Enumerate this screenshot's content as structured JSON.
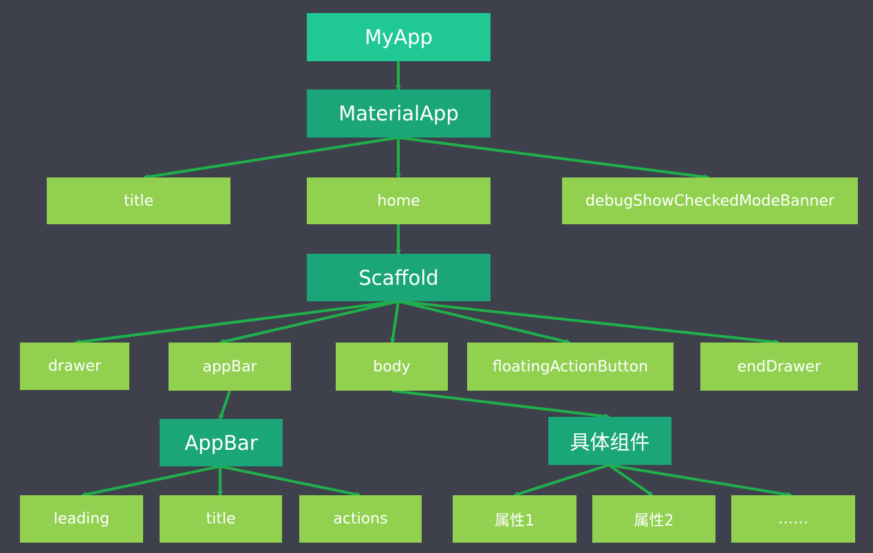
{
  "colors": {
    "background": "#3e414b",
    "root": "#20c894",
    "widget": "#1ba679",
    "property": "#92d050",
    "arrow": "#1fb04c"
  },
  "nodes": [
    {
      "id": "myapp",
      "label": "MyApp",
      "kind": "top"
    },
    {
      "id": "materialapp",
      "label": "MaterialApp",
      "kind": "mid"
    },
    {
      "id": "title",
      "label": "title",
      "kind": "leaf"
    },
    {
      "id": "home",
      "label": "home",
      "kind": "leaf"
    },
    {
      "id": "debug",
      "label": "debugShowCheckedModeBanner",
      "kind": "leaf"
    },
    {
      "id": "scaffold",
      "label": "Scaffold",
      "kind": "mid"
    },
    {
      "id": "drawer",
      "label": "drawer",
      "kind": "leaf"
    },
    {
      "id": "appbarprop",
      "label": "appBar",
      "kind": "leaf"
    },
    {
      "id": "body",
      "label": "body",
      "kind": "leaf"
    },
    {
      "id": "fab",
      "label": "floatingActionButton",
      "kind": "leaf"
    },
    {
      "id": "enddrawer",
      "label": "endDrawer",
      "kind": "leaf"
    },
    {
      "id": "appbar",
      "label": "AppBar",
      "kind": "mid"
    },
    {
      "id": "widget",
      "label": "具体组件",
      "kind": "mid"
    },
    {
      "id": "leading",
      "label": "leading",
      "kind": "leaf"
    },
    {
      "id": "title2",
      "label": "title",
      "kind": "leaf"
    },
    {
      "id": "actions",
      "label": "actions",
      "kind": "leaf"
    },
    {
      "id": "attr1",
      "label": "属性1",
      "kind": "leaf"
    },
    {
      "id": "attr2",
      "label": "属性2",
      "kind": "leaf"
    },
    {
      "id": "more",
      "label": "……",
      "kind": "leaf"
    }
  ],
  "edges": [
    [
      "myapp",
      "materialapp"
    ],
    [
      "materialapp",
      "title"
    ],
    [
      "materialapp",
      "home"
    ],
    [
      "materialapp",
      "debug"
    ],
    [
      "home",
      "scaffold"
    ],
    [
      "scaffold",
      "drawer"
    ],
    [
      "scaffold",
      "appbarprop"
    ],
    [
      "scaffold",
      "body"
    ],
    [
      "scaffold",
      "fab"
    ],
    [
      "scaffold",
      "enddrawer"
    ],
    [
      "appbarprop",
      "appbar"
    ],
    [
      "body",
      "widget"
    ],
    [
      "appbar",
      "leading"
    ],
    [
      "appbar",
      "title2"
    ],
    [
      "appbar",
      "actions"
    ],
    [
      "widget",
      "attr1"
    ],
    [
      "widget",
      "attr2"
    ],
    [
      "widget",
      "more"
    ]
  ]
}
